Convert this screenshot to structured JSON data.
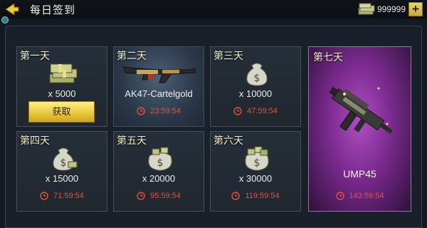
{
  "header": {
    "title": "每日签到",
    "currency_value": "999999",
    "plus_label": "+"
  },
  "icons": {
    "back": "back-arrow-icon",
    "currency": "cash-stack-icon",
    "clock": "clock-icon",
    "money_bag": "money-bag-icon",
    "weapon": "rifle-icon"
  },
  "colors": {
    "accent_gold": "#e9c93d",
    "timer_red": "#e0553a",
    "legendary_purple": "#7a2a8d"
  },
  "days": [
    {
      "label": "第一天",
      "amount": "x 5000",
      "action": "获取"
    },
    {
      "label": "第二天",
      "item": "AK47-Cartelgold",
      "timer": "23:59:54"
    },
    {
      "label": "第三天",
      "amount": "x 10000",
      "timer": "47:59:54"
    },
    {
      "label": "第四天",
      "amount": "x 15000",
      "timer": "71:59:54"
    },
    {
      "label": "第五天",
      "amount": "x 20000",
      "timer": "95:59:54"
    },
    {
      "label": "第六天",
      "amount": "x 30000",
      "timer": "119:59:54"
    },
    {
      "label": "第七天",
      "item": "UMP45",
      "timer": "143:59:54"
    }
  ]
}
